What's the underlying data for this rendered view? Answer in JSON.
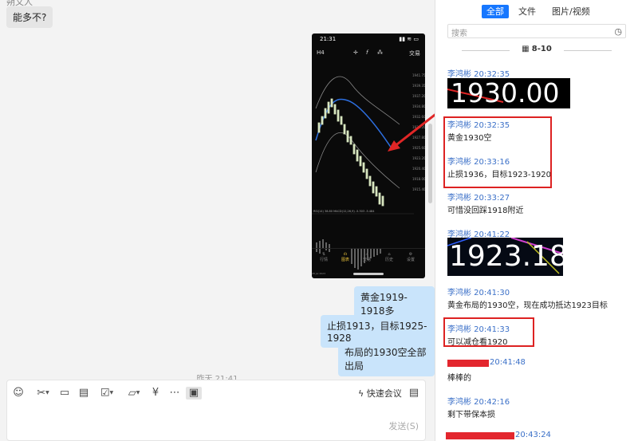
{
  "chat": {
    "sender_name_partial": "朔文人",
    "incoming_message": "能多不?",
    "outgoing_messages": [
      "黄金1919-1918多",
      "止损1913，目标1925-1928",
      "布局的1930空全部出局"
    ],
    "timestamp": "昨天 21:41"
  },
  "phone": {
    "time": "21:31",
    "trade_label": "交易",
    "indicator_text": "RSI(14) 38.80 MACD(12,26,9) -5.303 -5.484",
    "y_axis": [
      "1941.75",
      "1939.35",
      "1937.20",
      "1934.80",
      "1932.60",
      "1930.20",
      "1927.80",
      "1925.60",
      "1923.20",
      "1920.40",
      "1918.00",
      "1915.40"
    ],
    "tabs": [
      "行情",
      "图表",
      "交易",
      "历史",
      "设置"
    ]
  },
  "composer": {
    "quick_meeting": "快速会议",
    "send_label": "发送(S)"
  },
  "panel": {
    "tabs": [
      "全部",
      "文件",
      "图片/视频"
    ],
    "active_tab": "全部",
    "search_placeholder": "搜索",
    "date_header": "8-10",
    "messages": [
      {
        "header": "李鸿彬 20:32:35",
        "image_text": "1930.00"
      },
      {
        "header": "李鸿彬 20:32:35",
        "text": "黄金1930空"
      },
      {
        "header": "李鸿彬 20:33:16",
        "text": "止损1936，目标1923-1920"
      },
      {
        "header": "李鸿彬 20:33:27",
        "text": "可惜没回踩1918附近"
      },
      {
        "header": "李鸿彬 20:41:22",
        "image_text": "1923.18"
      },
      {
        "header": "李鸿彬 20:41:30",
        "text": "黄金布局的1930空，现在成功抵达1923目标"
      },
      {
        "header": "李鸿彬 20:41:33",
        "text": "可以减仓看1920"
      },
      {
        "header": "20:41:48",
        "text": "棒棒的"
      },
      {
        "header": "李鸿彬 20:42:16",
        "text": "剩下带保本损"
      },
      {
        "header": "20:43:24",
        "text": ""
      }
    ]
  },
  "colors": {
    "accent": "#1677ff",
    "bubble_out": "#c9e4fb",
    "highlight": "#dd2222",
    "name": "#3b70c8"
  }
}
